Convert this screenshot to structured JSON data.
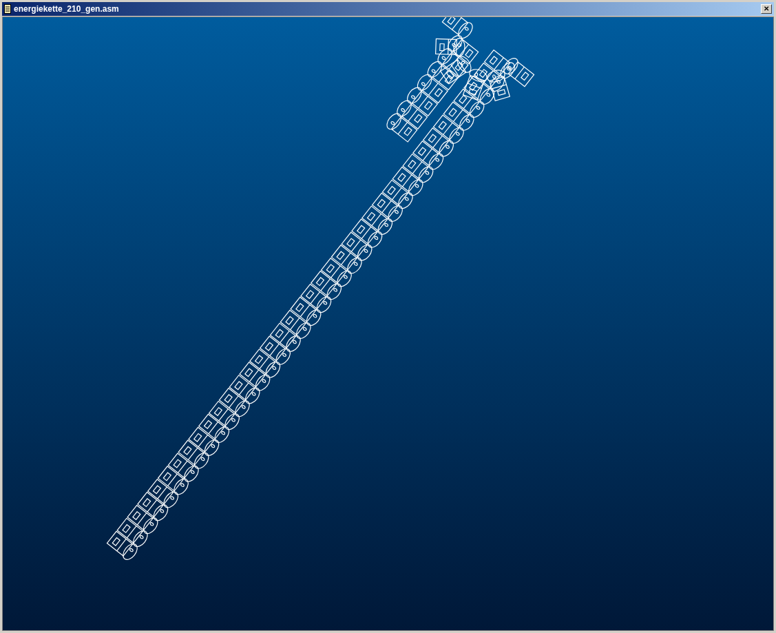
{
  "window": {
    "title": "energiekette_210_gen.asm",
    "close": "✕"
  }
}
